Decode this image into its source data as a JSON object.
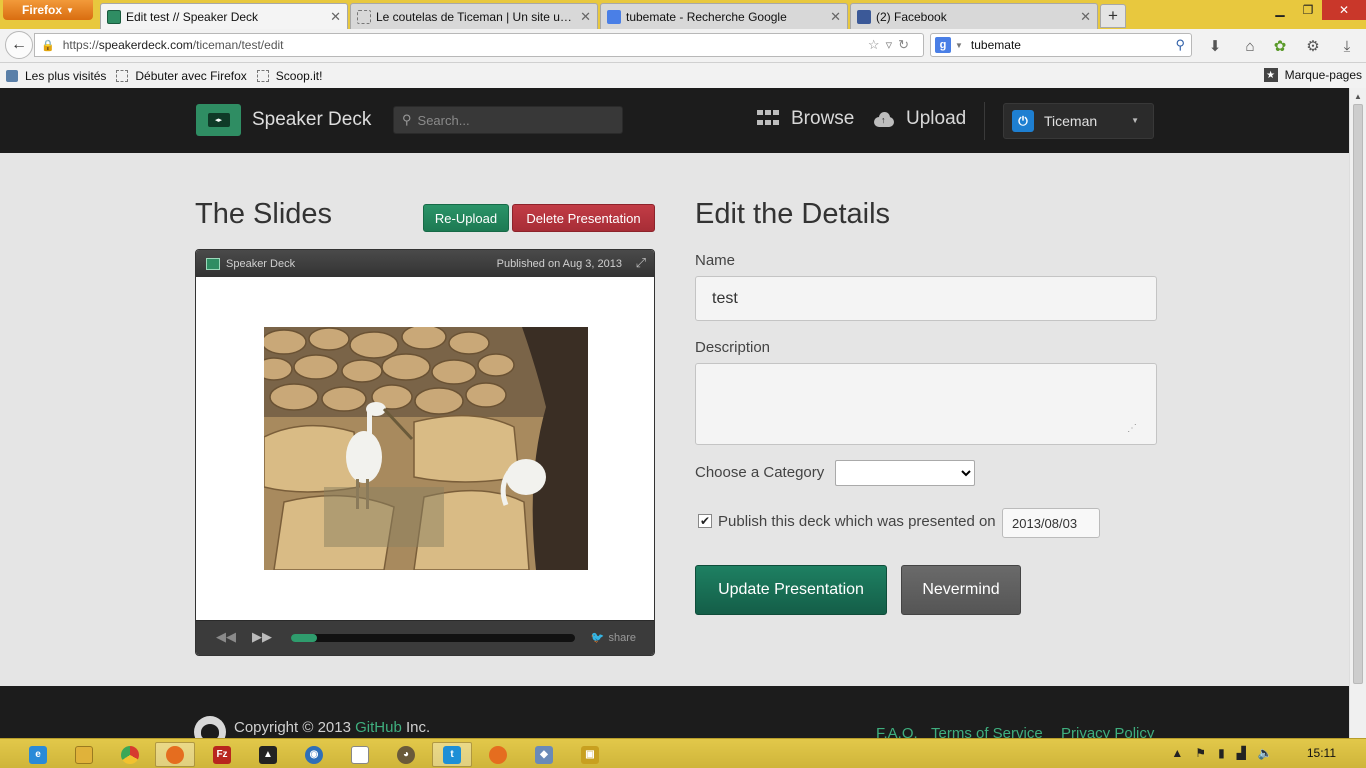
{
  "browser": {
    "menu_button": "Firefox",
    "tabs": [
      {
        "label": "Edit test // Speaker Deck",
        "active": true
      },
      {
        "label": "Le coutelas de Ticeman | Un site utilis...",
        "active": false
      },
      {
        "label": "tubemate - Recherche Google",
        "active": false
      },
      {
        "label": "(2) Facebook",
        "active": false
      }
    ],
    "new_tab": "+",
    "url_prefix": "https://",
    "url_host": "speakerdeck.com",
    "url_path": "/ticeman/test/edit",
    "search_value": "tubemate",
    "search_engine_icon": "g",
    "bookmarks": [
      "Les plus visités",
      "Débuter avec Firefox",
      "Scoop.it!"
    ],
    "bookmarks_menu": "Marque-pages"
  },
  "header": {
    "brand": "Speaker Deck",
    "search_placeholder": "Search...",
    "nav": [
      {
        "label": "Browse",
        "icon": "grid-icon"
      },
      {
        "label": "Upload",
        "icon": "cloud-upload-icon"
      }
    ],
    "user": "Ticeman"
  },
  "slides": {
    "title": "The Slides",
    "reupload_label": "Re-Upload",
    "delete_label": "Delete Presentation",
    "player_brand": "Speaker Deck",
    "published": "Published on Aug 3, 2013",
    "share_label": "share",
    "progress": 0.09
  },
  "details": {
    "title": "Edit the Details",
    "name_label": "Name",
    "name_value": "test",
    "description_label": "Description",
    "description_value": "",
    "category_label": "Choose a Category",
    "category_value": "",
    "publish_label": "Publish this deck which was presented on",
    "publish_checked": true,
    "publish_date": "2013/08/03",
    "update_label": "Update Presentation",
    "cancel_label": "Nevermind"
  },
  "footer": {
    "copyright_prefix": "Copyright © 2013 ",
    "copyright_link": "GitHub",
    "copyright_suffix": " Inc.",
    "links": [
      "F.A.Q.",
      "Terms of Service",
      "Privacy Policy"
    ]
  },
  "taskbar": {
    "clock": "15:11"
  },
  "colors": {
    "accent_green": "#1e8062",
    "danger_red": "#a72d36",
    "header_bg": "#1c1c1c",
    "taskbar": "#d8be40"
  }
}
